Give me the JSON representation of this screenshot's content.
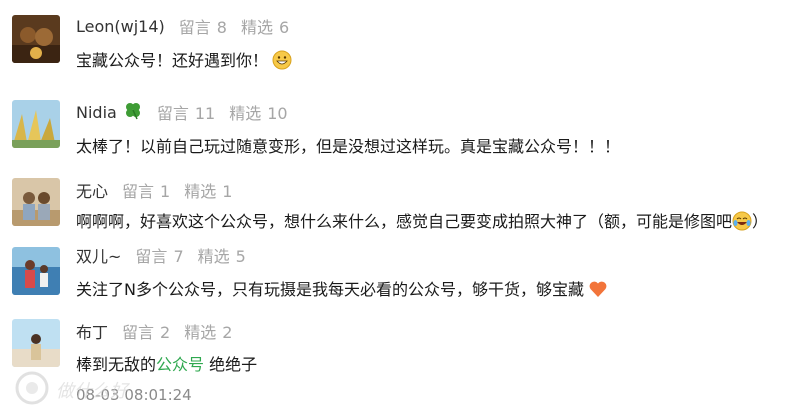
{
  "comments": [
    {
      "username": "Leon(wj14)",
      "comments_label": "留言",
      "comments_count": "8",
      "featured_label": "精选",
      "featured_count": "6",
      "text": "宝藏公众号！还好遇到你！",
      "emoji": "grinning-face"
    },
    {
      "username": "Nidia",
      "username_badge": "four-leaf-clover",
      "comments_label": "留言",
      "comments_count": "11",
      "featured_label": "精选",
      "featured_count": "10",
      "text": "太棒了！以前自己玩过随意变形，但是没想过这样玩。真是宝藏公众号！！！"
    },
    {
      "username": "无心",
      "comments_label": "留言",
      "comments_count": "1",
      "featured_label": "精选",
      "featured_count": "1",
      "text": "啊啊啊，好喜欢这个公众号，想什么来什么，感觉自己要变成拍照大神了（额，可能是修图吧",
      "text_end": "）",
      "emoji": "tears-of-joy-face"
    },
    {
      "username": "双儿~",
      "comments_label": "留言",
      "comments_count": "7",
      "featured_label": "精选",
      "featured_count": "5",
      "text": "关注了N多个公众号，只有玩摄是我每天必看的公众号，够干货，够宝藏",
      "emoji": "orange-heart"
    },
    {
      "username": "布丁",
      "comments_label": "留言",
      "comments_count": "2",
      "featured_label": "精选",
      "featured_count": "2",
      "text_pre": "棒到无敌的",
      "text_link": "公众号",
      "text_post": " 绝绝子",
      "time": "08-03 08:01:24"
    }
  ],
  "watermark": {
    "text": "做什么好"
  },
  "colors": {
    "meta": "#a6a6a6",
    "text": "#1a1a1a",
    "link": "#2fa84f"
  }
}
